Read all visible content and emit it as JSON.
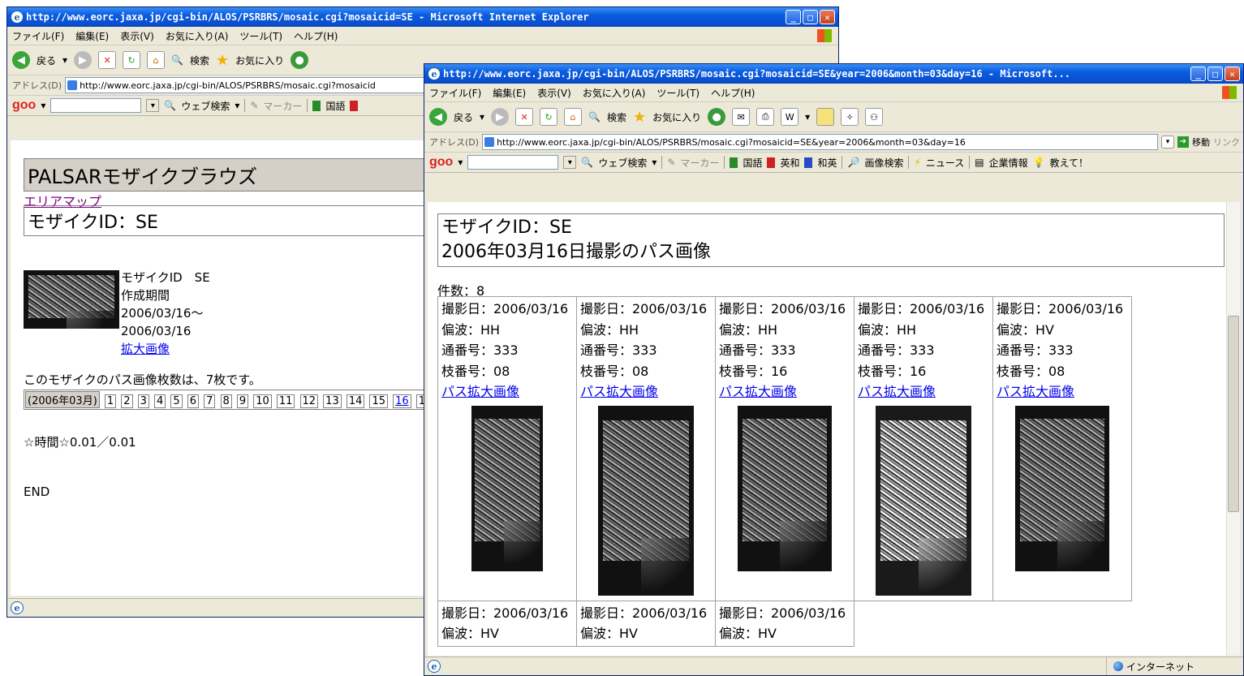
{
  "back_window": {
    "title": "http://www.eorc.jaxa.jp/cgi-bin/ALOS/PSRBRS/mosaic.cgi?mosaicid=SE - Microsoft Internet Explorer",
    "menu": [
      "ファイル(F)",
      "編集(E)",
      "表示(V)",
      "お気に入り(A)",
      "ツール(T)",
      "ヘルプ(H)"
    ],
    "toolbar": {
      "back": "戻る",
      "search": "検索",
      "favorites": "お気に入り"
    },
    "address_label": "アドレス(D)",
    "address_url": "http://www.eorc.jaxa.jp/cgi-bin/ALOS/PSRBRS/mosaic.cgi?mosaicid",
    "goo": {
      "logo": "goo",
      "web_search": "ウェブ検索",
      "marker": "マーカー",
      "kokugo": "国語"
    },
    "page": {
      "header": "PALSARモザイクブラウズ",
      "area_map_link": "エリアマップ",
      "mosaic_id_header": "モザイクID：SE",
      "thumb_caption": {
        "id_line": "モザイクID　SE",
        "period_label": "作成期間",
        "period_start": "2006/03/16〜",
        "period_end": "2006/03/16",
        "enlarge_link": "拡大画像"
      },
      "count_text": "このモザイクのパス画像枚数は、7枚です。",
      "month_label": "(2006年03月)",
      "days": [
        "1",
        "2",
        "3",
        "4",
        "5",
        "6",
        "7",
        "8",
        "9",
        "10",
        "11",
        "12",
        "13",
        "14",
        "15",
        "16",
        "1"
      ],
      "time_text": "☆時間☆0.01／0.01",
      "end_text": "END"
    }
  },
  "front_window": {
    "title": "http://www.eorc.jaxa.jp/cgi-bin/ALOS/PSRBRS/mosaic.cgi?mosaicid=SE&year=2006&month=03&day=16 - Microsoft...",
    "menu": [
      "ファイル(F)",
      "編集(E)",
      "表示(V)",
      "お気に入り(A)",
      "ツール(T)",
      "ヘルプ(H)"
    ],
    "toolbar": {
      "back": "戻る",
      "search": "検索",
      "favorites": "お気に入り"
    },
    "address_label": "アドレス(D)",
    "address_url": "http://www.eorc.jaxa.jp/cgi-bin/ALOS/PSRBRS/mosaic.cgi?mosaicid=SE&year=2006&month=03&day=16",
    "go_label": "移動",
    "links_label": "リンク",
    "goo": {
      "logo": "goo",
      "web_search": "ウェブ検索",
      "marker": "マーカー",
      "kokugo": "国語",
      "eiwa": "英和",
      "waei": "和英",
      "image_search": "画像検索",
      "news": "ニュース",
      "company": "企業情報",
      "oshiete": "教えて！"
    },
    "page": {
      "header_line1": "モザイクID：SE",
      "header_line2": "2006年03月16日撮影のパス画像",
      "count": "件数：8",
      "link_text": "パス拡大画像",
      "row1": [
        {
          "date": "撮影日：2006/03/16",
          "pol": "偏波：HH",
          "serial": "通番号：333",
          "branch": "枝番号：08"
        },
        {
          "date": "撮影日：2006/03/16",
          "pol": "偏波：HH",
          "serial": "通番号：333",
          "branch": "枝番号：08"
        },
        {
          "date": "撮影日：2006/03/16",
          "pol": "偏波：HH",
          "serial": "通番号：333",
          "branch": "枝番号：16"
        },
        {
          "date": "撮影日：2006/03/16",
          "pol": "偏波：HH",
          "serial": "通番号：333",
          "branch": "枝番号：16"
        },
        {
          "date": "撮影日：2006/03/16",
          "pol": "偏波：HV",
          "serial": "通番号：333",
          "branch": "枝番号：08"
        }
      ],
      "row2": [
        {
          "date": "撮影日：2006/03/16",
          "pol": "偏波：HV"
        },
        {
          "date": "撮影日：2006/03/16",
          "pol": "偏波：HV"
        },
        {
          "date": "撮影日：2006/03/16",
          "pol": "偏波：HV"
        }
      ]
    },
    "status_zone": "インターネット"
  }
}
